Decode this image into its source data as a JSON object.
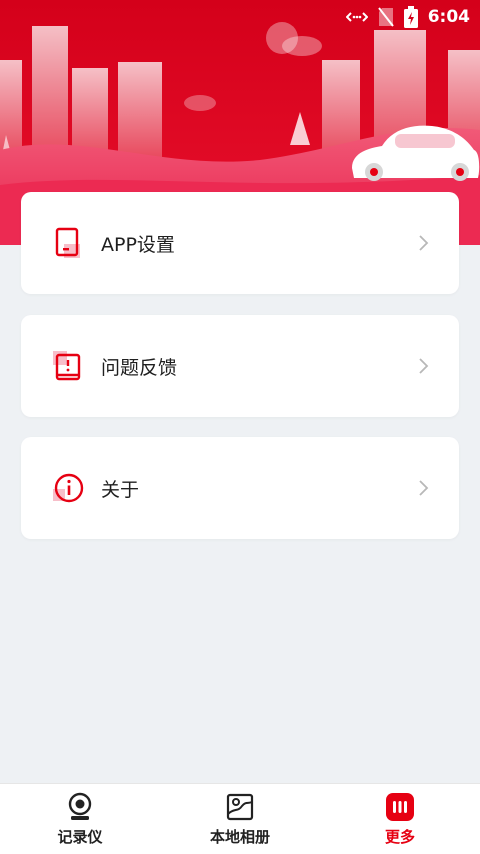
{
  "status_bar": {
    "time": "6:04"
  },
  "menu": [
    {
      "label": "APP设置",
      "icon": "tablet-settings-icon"
    },
    {
      "label": "问题反馈",
      "icon": "feedback-book-icon"
    },
    {
      "label": "关于",
      "icon": "info-icon"
    }
  ],
  "tabbar": [
    {
      "label": "记录仪",
      "icon": "dashcam-icon",
      "active": false
    },
    {
      "label": "本地相册",
      "icon": "album-icon",
      "active": false
    },
    {
      "label": "更多",
      "icon": "more-dots-icon",
      "active": true
    }
  ],
  "colors": {
    "brand": "#e60012",
    "background": "#eef1f4"
  }
}
